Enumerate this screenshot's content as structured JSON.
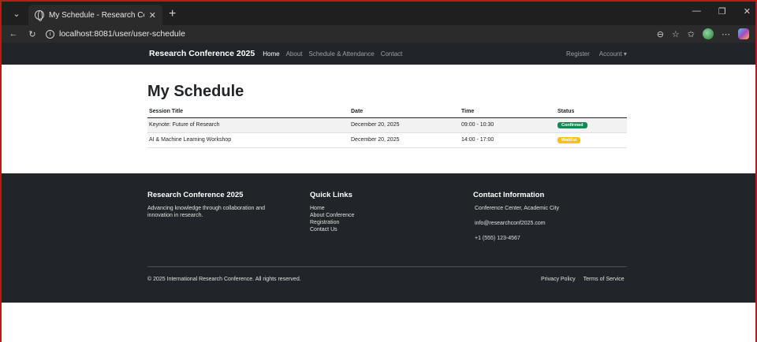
{
  "browser": {
    "tab_title": "My Schedule - Research Conferen",
    "url": "localhost:8081/user/user-schedule",
    "new_tab_symbol": "+"
  },
  "navbar": {
    "brand": "Research Conference 2025",
    "links": [
      "Home",
      "About",
      "Schedule & Attendance",
      "Contact"
    ],
    "register": "Register",
    "account": "Account ▾"
  },
  "page": {
    "title": "My Schedule",
    "columns": [
      "Session Title",
      "Date",
      "Time",
      "Status"
    ],
    "rows": [
      {
        "title": "Keynote: Future of Research",
        "date": "December 20, 2025",
        "time": "09:00 - 10:30",
        "status": "Confirmed",
        "status_color": "#198754"
      },
      {
        "title": "AI & Machine Learning Workshop",
        "date": "December 20, 2025",
        "time": "14:00 - 17:00",
        "status": "Waitlist",
        "status_color": "#ffc107"
      }
    ]
  },
  "footer": {
    "about_title": "Research Conference 2025",
    "about_text_1": "Advancing knowledge through collaboration and",
    "about_text_2": "innovation in research.",
    "links_title": "Quick Links",
    "links": [
      "Home",
      "About Conference",
      "Registration",
      "Contact Us"
    ],
    "contact_title": "Contact Information",
    "contact": [
      "Conference Center, Academic City",
      "info@researchconf2025.com",
      "+1 (555) 123-4567"
    ],
    "copyright": "© 2025 International Research Conference. All rights reserved.",
    "privacy": "Privacy Policy",
    "terms": "Terms of Service"
  }
}
